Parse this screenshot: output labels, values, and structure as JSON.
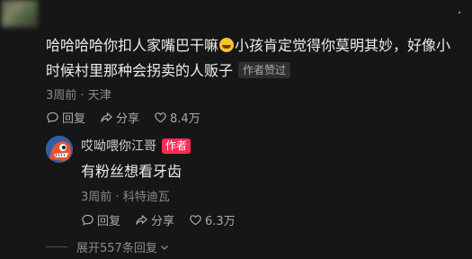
{
  "comment": {
    "text_before_emoji": "哈哈哈哈你扣人家嘴巴干嘛",
    "emoji": "laughing-tears",
    "text_after_emoji": "小孩肯定觉得你莫明其妙，好像小时候村里那种会拐卖的人贩子",
    "tag": "作者赞过",
    "time": "3周前",
    "location": "天津",
    "reply_label": "回复",
    "share_label": "分享",
    "likes": "8.4万"
  },
  "reply": {
    "username": "哎呦喂你江哥",
    "badge": "作者",
    "text": "有粉丝想看牙齿",
    "time": "3周前",
    "location": "科特迪瓦",
    "reply_label": "回复",
    "share_label": "分享",
    "likes": "6.3万"
  },
  "expand": {
    "label": "展开557条回复"
  },
  "colors": {
    "background": "#161616",
    "author_badge": "#fe2c55"
  }
}
